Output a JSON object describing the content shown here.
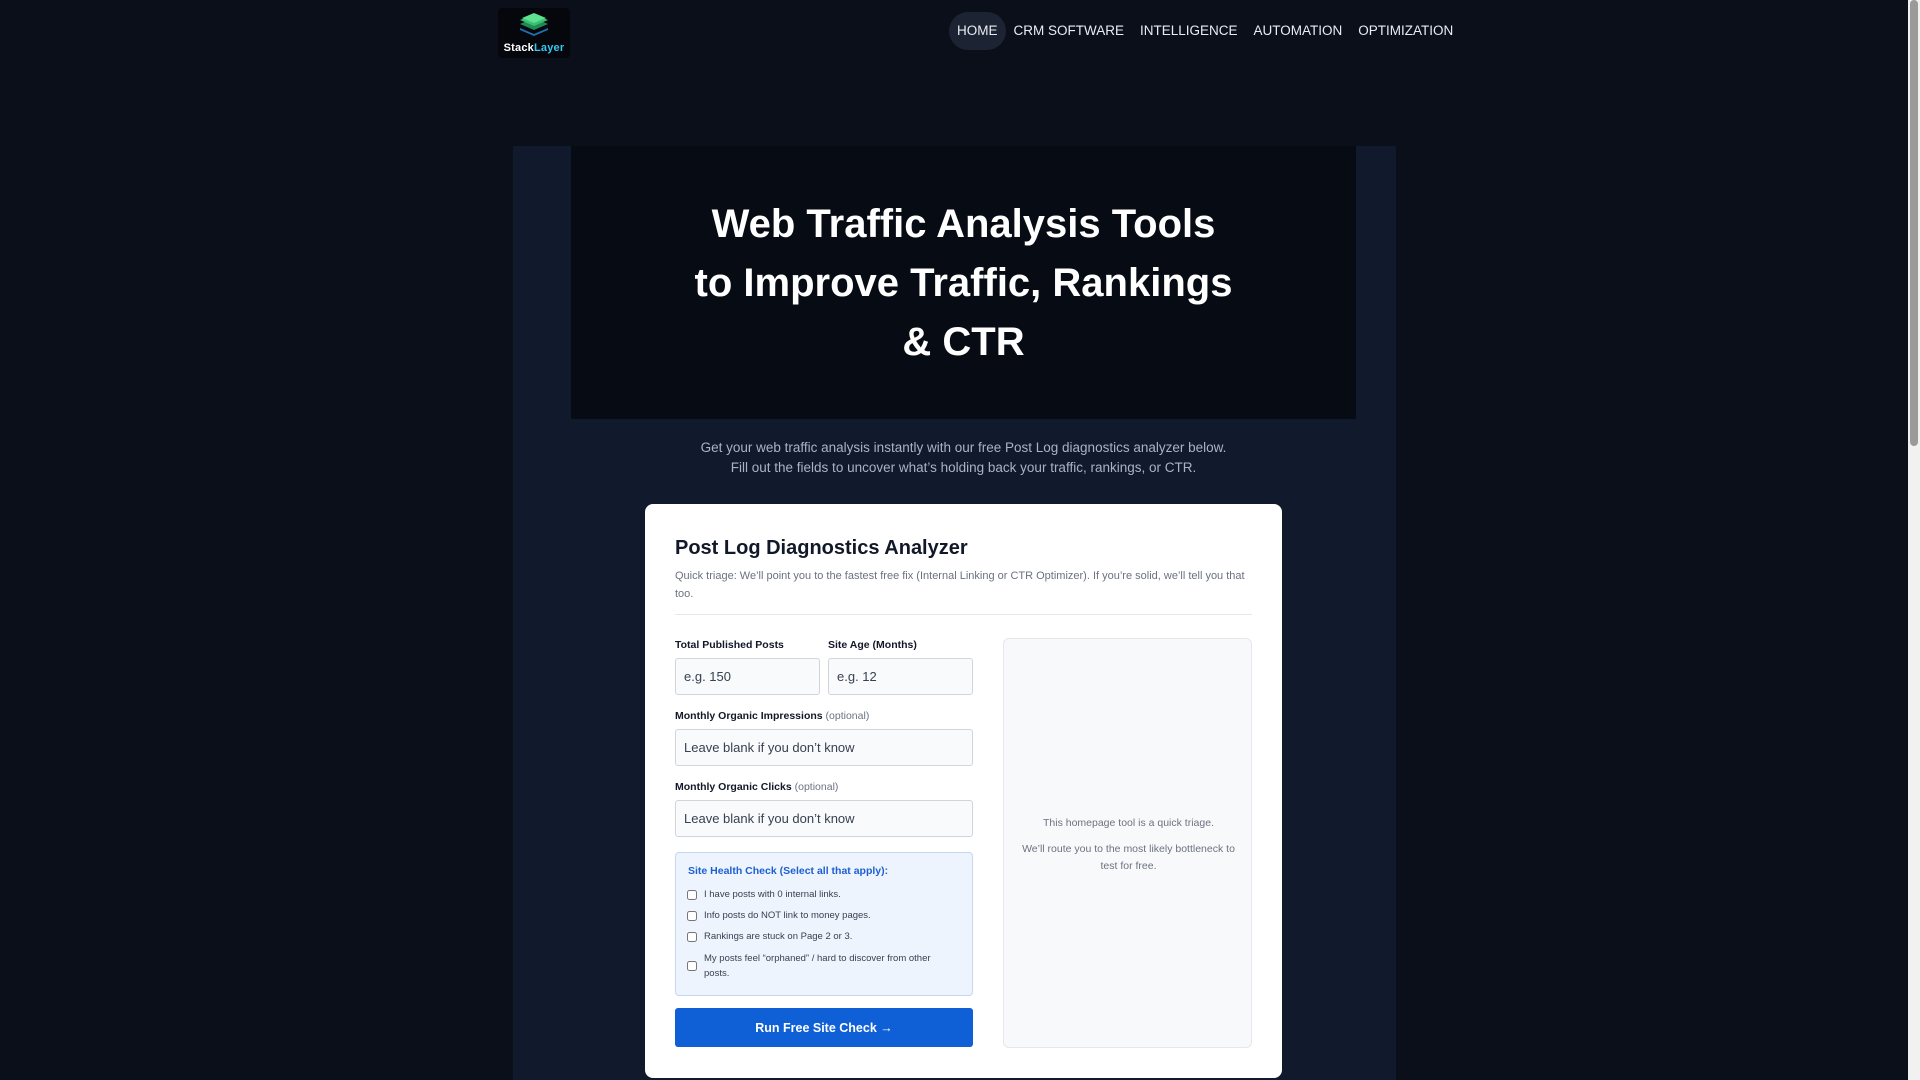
{
  "brand": {
    "name_part1": "Stack",
    "name_part2": "Layer",
    "logo_icon": "layers-icon",
    "accent_color": "#36c6f0"
  },
  "nav": {
    "items": [
      {
        "label": "HOME",
        "active": true
      },
      {
        "label": "CRM SOFTWARE",
        "active": false
      },
      {
        "label": "INTELLIGENCE",
        "active": false
      },
      {
        "label": "AUTOMATION",
        "active": false
      },
      {
        "label": "OPTIMIZATION",
        "active": false
      }
    ]
  },
  "hero": {
    "title": "Web Traffic Analysis Tools to Improve Traffic, Rankings & CTR",
    "intro_line1": "Get your web traffic analysis instantly with our free Post Log diagnostics analyzer below.",
    "intro_line2": "Fill out the fields to uncover what’s holding back your traffic, rankings, or CTR."
  },
  "analyzer": {
    "title": "Post Log Diagnostics Analyzer",
    "subtitle": "Quick triage: We’ll point you to the fastest free fix (Internal Linking or CTR Optimizer). If you’re solid, we’ll tell you that too.",
    "fields": {
      "total_posts": {
        "label": "Total Published Posts",
        "placeholder": "e.g. 150",
        "value": ""
      },
      "site_age": {
        "label": "Site Age (Months)",
        "placeholder": "e.g. 12",
        "value": ""
      },
      "impressions": {
        "label": "Monthly Organic Impressions",
        "optional": "(optional)",
        "placeholder": "Leave blank if you don’t know",
        "value": ""
      },
      "clicks": {
        "label": "Monthly Organic Clicks",
        "optional": "(optional)",
        "placeholder": "Leave blank if you don’t know",
        "value": ""
      }
    },
    "health_check": {
      "title": "Site Health Check (Select all that apply):",
      "items": [
        {
          "label": "I have posts with 0 internal links.",
          "checked": false
        },
        {
          "label": "Info posts do NOT link to money pages.",
          "checked": false
        },
        {
          "label": "Rankings are stuck on Page 2 or 3.",
          "checked": false
        },
        {
          "label": "My posts feel “orphaned” / hard to discover from other posts.",
          "checked": false
        }
      ]
    },
    "submit_label": "Run Free Site Check →",
    "submit_color": "#0f5fd6",
    "result": {
      "line1": "This homepage tool is a quick triage.",
      "line2": "We’ll route you to the most likely bottleneck to test for free."
    }
  }
}
